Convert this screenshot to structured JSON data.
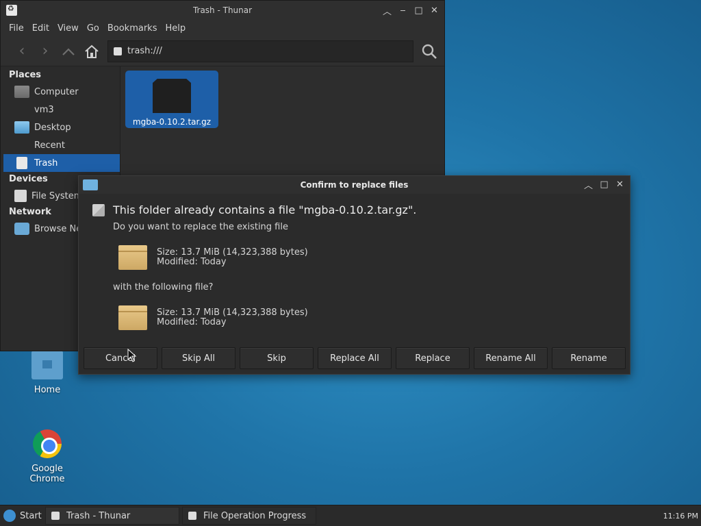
{
  "desktop": {
    "icons": [
      {
        "label": "Home",
        "icon": "home-folder-icon"
      },
      {
        "label": "Google Chrome",
        "icon": "chrome-icon"
      }
    ]
  },
  "thunar": {
    "title": "Trash - Thunar",
    "menu": [
      "File",
      "Edit",
      "View",
      "Go",
      "Bookmarks",
      "Help"
    ],
    "location": "trash:///",
    "sidebar": {
      "places_header": "Places",
      "places": [
        {
          "label": "Computer",
          "icon": "computer-icon"
        },
        {
          "label": "vm3",
          "icon": ""
        },
        {
          "label": "Desktop",
          "icon": "desktop-folder-icon"
        },
        {
          "label": "Recent",
          "icon": ""
        },
        {
          "label": "Trash",
          "icon": "trash-icon",
          "selected": true
        }
      ],
      "devices_header": "Devices",
      "devices": [
        {
          "label": "File System",
          "icon": "drive-icon"
        }
      ],
      "network_header": "Network",
      "network": [
        {
          "label": "Browse Network",
          "icon": "network-icon"
        }
      ]
    },
    "files": [
      {
        "name": "mgba-0.10.2.tar.gz",
        "icon": "archive-icon",
        "selected": true
      }
    ]
  },
  "dialog": {
    "title": "Confirm to replace files",
    "heading": "This folder already contains a file \"mgba-0.10.2.tar.gz\".",
    "question_existing": "Do you want to replace the existing file",
    "existing": {
      "size": "Size: 13.7 MiB (14,323,388 bytes)",
      "modified": "Modified: Today"
    },
    "question_new": "with the following file?",
    "new": {
      "size": "Size: 13.7 MiB (14,323,388 bytes)",
      "modified": "Modified: Today"
    },
    "buttons": {
      "cancel": "Cancel",
      "skip_all": "Skip All",
      "skip": "Skip",
      "replace_all": "Replace All",
      "replace": "Replace",
      "rename_all": "Rename All",
      "rename": "Rename"
    }
  },
  "taskbar": {
    "start": "Start",
    "tasks": [
      "Trash - Thunar",
      "File Operation Progress"
    ],
    "clock": "11:16 PM"
  }
}
